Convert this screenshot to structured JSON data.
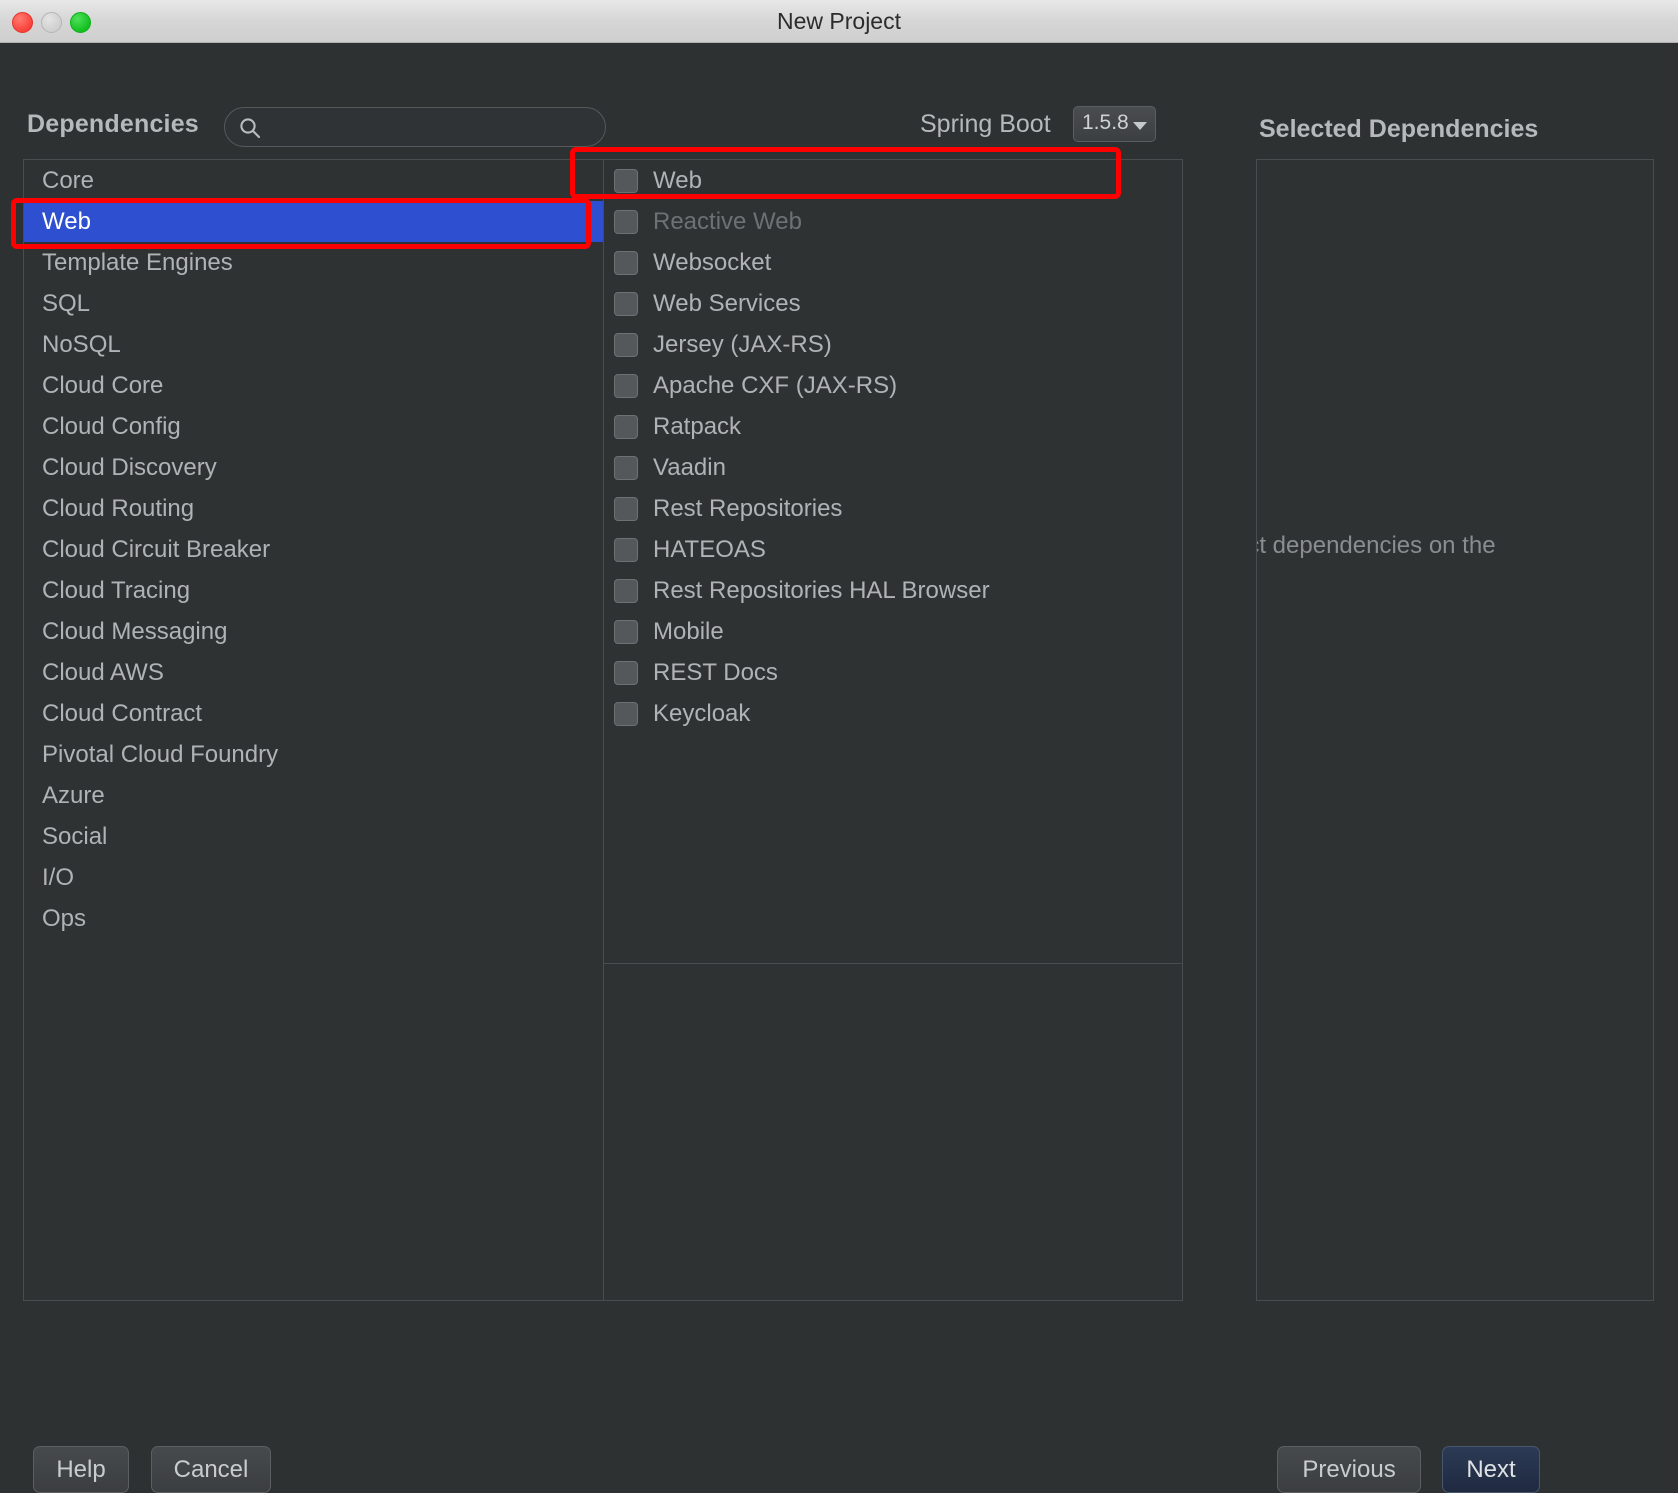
{
  "window": {
    "title": "New Project",
    "traffic_lights": [
      "close-button",
      "minimize-button",
      "maximize-button"
    ]
  },
  "header": {
    "dependencies_label": "Dependencies",
    "search": {
      "value": "",
      "placeholder": "",
      "icon": "search-icon"
    },
    "spring_boot_label": "Spring Boot",
    "spring_boot_version": "1.5.8",
    "selected_dependencies_label": "Selected Dependencies"
  },
  "categories": [
    {
      "label": "Core",
      "selected": false
    },
    {
      "label": "Web",
      "selected": true
    },
    {
      "label": "Template Engines",
      "selected": false
    },
    {
      "label": "SQL",
      "selected": false
    },
    {
      "label": "NoSQL",
      "selected": false
    },
    {
      "label": "Cloud Core",
      "selected": false
    },
    {
      "label": "Cloud Config",
      "selected": false
    },
    {
      "label": "Cloud Discovery",
      "selected": false
    },
    {
      "label": "Cloud Routing",
      "selected": false
    },
    {
      "label": "Cloud Circuit Breaker",
      "selected": false
    },
    {
      "label": "Cloud Tracing",
      "selected": false
    },
    {
      "label": "Cloud Messaging",
      "selected": false
    },
    {
      "label": "Cloud AWS",
      "selected": false
    },
    {
      "label": "Cloud Contract",
      "selected": false
    },
    {
      "label": "Pivotal Cloud Foundry",
      "selected": false
    },
    {
      "label": "Azure",
      "selected": false
    },
    {
      "label": "Social",
      "selected": false
    },
    {
      "label": "I/O",
      "selected": false
    },
    {
      "label": "Ops",
      "selected": false
    }
  ],
  "dependencies": [
    {
      "label": "Web",
      "checked": false,
      "disabled": false
    },
    {
      "label": "Reactive Web",
      "checked": false,
      "disabled": true
    },
    {
      "label": "Websocket",
      "checked": false,
      "disabled": false
    },
    {
      "label": "Web Services",
      "checked": false,
      "disabled": false
    },
    {
      "label": "Jersey (JAX-RS)",
      "checked": false,
      "disabled": false
    },
    {
      "label": "Apache CXF (JAX-RS)",
      "checked": false,
      "disabled": false
    },
    {
      "label": "Ratpack",
      "checked": false,
      "disabled": false
    },
    {
      "label": "Vaadin",
      "checked": false,
      "disabled": false
    },
    {
      "label": "Rest Repositories",
      "checked": false,
      "disabled": false
    },
    {
      "label": "HATEOAS",
      "checked": false,
      "disabled": false
    },
    {
      "label": "Rest Repositories HAL Browser",
      "checked": false,
      "disabled": false
    },
    {
      "label": "Mobile",
      "checked": false,
      "disabled": false
    },
    {
      "label": "REST Docs",
      "checked": false,
      "disabled": false
    },
    {
      "label": "Keycloak",
      "checked": false,
      "disabled": false
    }
  ],
  "selected_panel": {
    "hint_text": "ect dependencies on the",
    "items": []
  },
  "footer": {
    "help": "Help",
    "cancel": "Cancel",
    "previous": "Previous",
    "next": "Next"
  },
  "annotations": [
    {
      "name": "highlight-category-web",
      "color": "#ff0000"
    },
    {
      "name": "highlight-dependency-web",
      "color": "#ff0000"
    }
  ],
  "colors": {
    "dialog_bg": "#2e3132",
    "selection_blue": "#2f4fd1",
    "annotation_red": "#ff0000",
    "text": "#b0b3b5",
    "default_button_blue": "#2c3a55"
  }
}
